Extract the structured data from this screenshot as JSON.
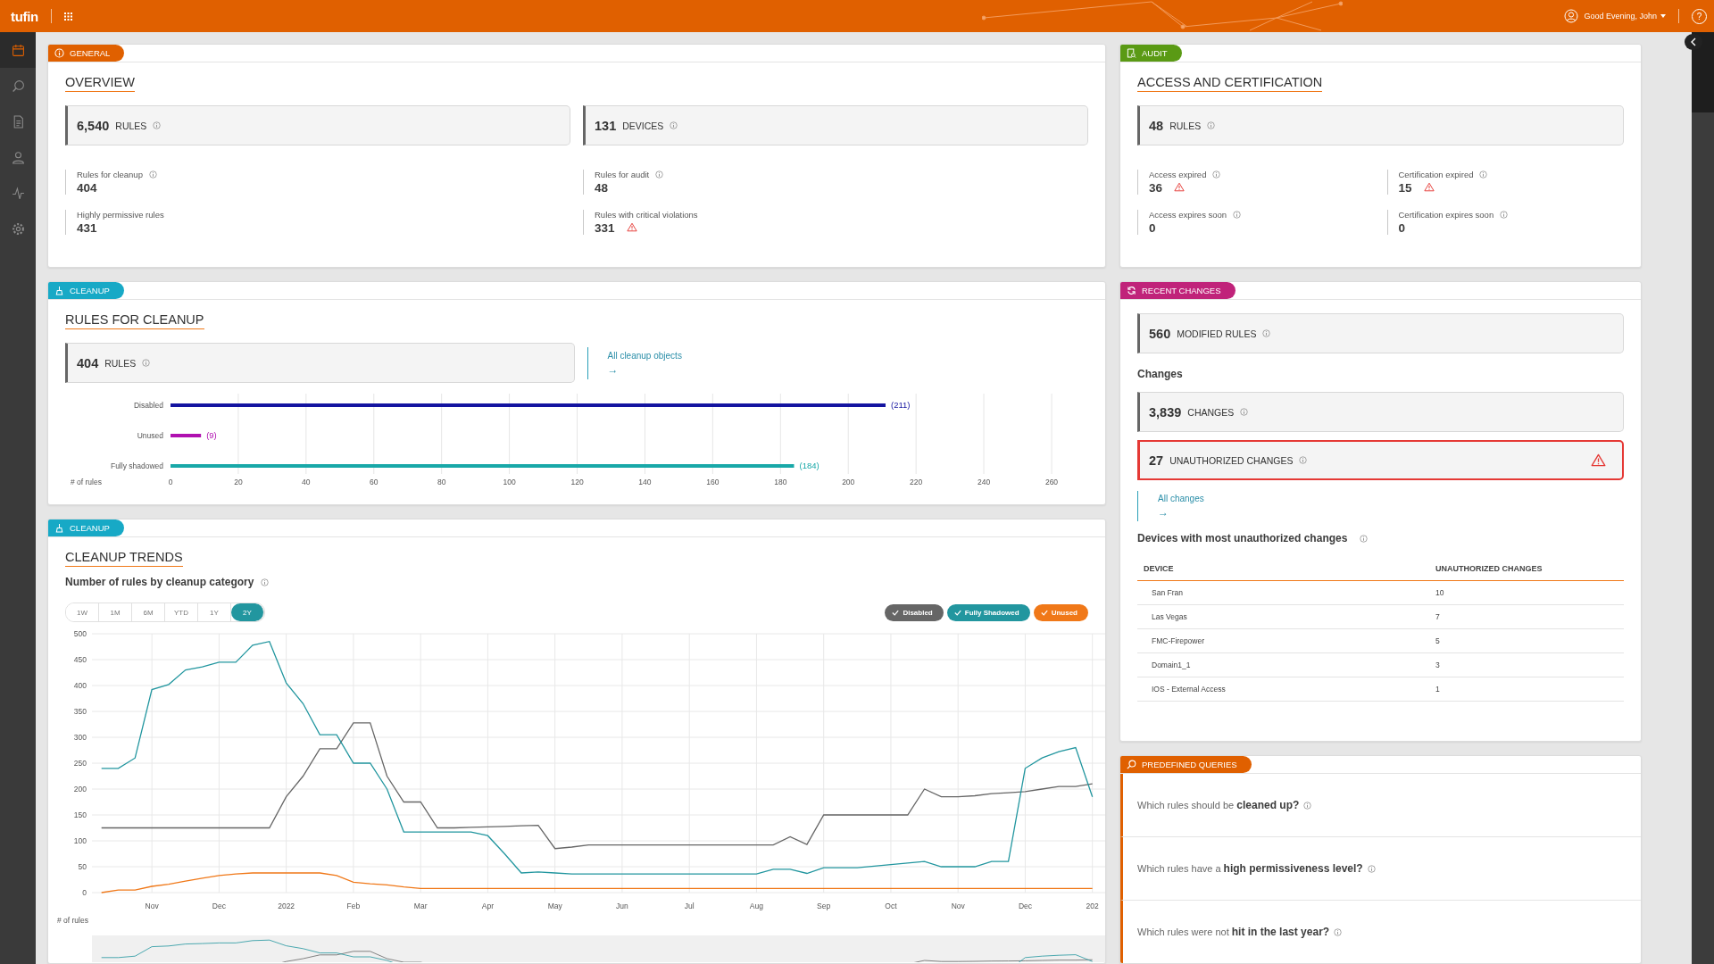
{
  "top_bar": {
    "logo": "tufin",
    "greeting": "Good Evening, John",
    "help": "?"
  },
  "sidebar": {
    "items": [
      {
        "selected": true
      },
      {
        "selected": false
      },
      {
        "selected": false
      },
      {
        "selected": false
      },
      {
        "selected": false
      },
      {
        "selected": false
      }
    ]
  },
  "general": {
    "tag": {
      "label": "GENERAL",
      "color": "#e06000"
    },
    "title": "OVERVIEW",
    "stats": [
      {
        "value": "6,540",
        "label": "RULES",
        "alert": false
      },
      {
        "value": "131",
        "label": "DEVICES",
        "alert": false
      }
    ],
    "metrics": [
      {
        "label": "Rules for cleanup",
        "value": "404",
        "info": true,
        "warning": false
      },
      {
        "label": "Rules for audit",
        "value": "48",
        "info": true,
        "warning": false
      },
      {
        "label": "Highly permissive rules",
        "value": "431",
        "info": false,
        "warning": false
      },
      {
        "label": "Rules with critical violations",
        "value": "331",
        "info": false,
        "warning": true
      }
    ]
  },
  "cleanup": {
    "tag": {
      "label": "CLEANUP",
      "color": "#17a9c6"
    },
    "title": "RULES FOR CLEANUP",
    "stat": {
      "value": "404",
      "label": "RULES",
      "alert": false
    },
    "link": {
      "label": "All cleanup objects",
      "arrow": "→"
    },
    "axis_caption": "# of rules",
    "chart_data": {
      "type": "bar",
      "orientation": "horizontal",
      "series": [
        {
          "name": "Disabled",
          "color": "#1414a0",
          "values": [
            211
          ]
        },
        {
          "name": "Unused",
          "color": "#b010b0",
          "values": [
            9
          ]
        },
        {
          "name": "Fully shadowed",
          "color": "#18a8a8",
          "values": [
            184
          ]
        }
      ],
      "value_labels": [
        "(211)",
        "(9)",
        "(184)"
      ],
      "grid": true,
      "xlim": [
        0,
        260
      ],
      "xticks": [
        0,
        20,
        40,
        60,
        80,
        100,
        120,
        140,
        160,
        180,
        200,
        220,
        240,
        260
      ]
    }
  },
  "trends": {
    "tag": {
      "label": "CLEANUP",
      "color": "#17a9c6"
    },
    "title": "CLEANUP TRENDS",
    "ranges": [
      {
        "label": "1W",
        "selected": false
      },
      {
        "label": "1M",
        "selected": false
      },
      {
        "label": "6M",
        "selected": false
      },
      {
        "label": "YTD",
        "selected": false
      },
      {
        "label": "1Y",
        "selected": false
      },
      {
        "label": "2Y",
        "selected": true
      }
    ],
    "legend": [
      {
        "checked": true
      },
      {
        "checked": true
      },
      {
        "checked": true
      }
    ],
    "chart_data": {
      "type": "line",
      "grid": true,
      "title": "Number of rules by cleanup category",
      "ylabel": "# of rules",
      "ylim": [
        0,
        500
      ],
      "yticks": [
        0,
        50,
        100,
        150,
        200,
        250,
        300,
        350,
        400,
        450,
        500
      ],
      "categories": [
        null,
        null,
        null,
        "Nov",
        null,
        null,
        null,
        "Dec",
        null,
        null,
        null,
        "2022",
        null,
        null,
        null,
        "Feb",
        null,
        null,
        null,
        "Mar",
        null,
        null,
        null,
        "Apr",
        null,
        null,
        null,
        "May",
        null,
        null,
        null,
        "Jun",
        null,
        null,
        null,
        "Jul",
        null,
        null,
        null,
        "Aug",
        null,
        null,
        null,
        "Sep",
        null,
        null,
        null,
        "Oct",
        null,
        null,
        null,
        "Nov",
        null,
        null,
        null,
        "Dec",
        null,
        null,
        null,
        "202"
      ],
      "series": [
        {
          "name": "Disabled",
          "color": "#666666",
          "values": [
            125,
            125,
            125,
            125,
            125,
            125,
            125,
            125,
            125,
            125,
            125,
            185,
            225,
            278,
            278,
            328,
            328,
            225,
            175,
            175,
            125,
            125,
            126,
            127,
            128,
            129,
            130,
            85,
            88,
            92,
            92,
            92,
            92,
            92,
            92,
            92,
            92,
            92,
            92,
            92,
            92,
            108,
            93,
            150,
            150,
            150,
            150,
            150,
            150,
            200,
            185,
            185,
            187,
            191,
            193,
            195,
            200,
            205,
            205,
            210
          ]
        },
        {
          "name": "Fully Shadowed",
          "color": "#22969f",
          "values": [
            240,
            240,
            260,
            392,
            402,
            430,
            436,
            445,
            445,
            478,
            485,
            405,
            365,
            305,
            305,
            250,
            250,
            200,
            117,
            117,
            117,
            117,
            117,
            110,
            75,
            38,
            40,
            38,
            36,
            36,
            36,
            36,
            36,
            36,
            36,
            36,
            36,
            36,
            36,
            36,
            45,
            45,
            37,
            48,
            48,
            48,
            51,
            54,
            57,
            60,
            50,
            50,
            50,
            60,
            60,
            240,
            260,
            272,
            280,
            185
          ]
        },
        {
          "name": "Unused",
          "color": "#f07818",
          "values": [
            0,
            5,
            5,
            12,
            16,
            22,
            28,
            33,
            36,
            38,
            38,
            38,
            38,
            38,
            33,
            20,
            17,
            15,
            11,
            8,
            8,
            8,
            8,
            8,
            8,
            8,
            8,
            8,
            8,
            8,
            8,
            8,
            8,
            8,
            8,
            8,
            8,
            8,
            8,
            8,
            8,
            8,
            8,
            8,
            8,
            8,
            8,
            8,
            8,
            8,
            8,
            8,
            8,
            8,
            8,
            8,
            8,
            8,
            8,
            8
          ]
        }
      ]
    }
  },
  "audit": {
    "tag": {
      "label": "AUDIT",
      "color": "#5a9a14"
    },
    "title": "ACCESS AND CERTIFICATION",
    "stat": {
      "value": "48",
      "label": "RULES",
      "alert": false
    },
    "metrics": [
      {
        "label": "Access expired",
        "value": "36",
        "info": true,
        "warning": true
      },
      {
        "label": "Certification expired",
        "value": "15",
        "info": true,
        "warning": true
      },
      {
        "label": "Access expires soon",
        "value": "0",
        "info": true,
        "warning": false
      },
      {
        "label": "Certification expires soon",
        "value": "0",
        "info": true,
        "warning": false
      }
    ]
  },
  "recent_changes": {
    "tag": {
      "label": "RECENT CHANGES",
      "color": "#c0237a"
    },
    "stat": {
      "value": "560",
      "label": "MODIFIED RULES",
      "alert": false
    },
    "changes_heading": "Changes",
    "change_stats": [
      {
        "value": "3,839",
        "label": "CHANGES",
        "alert": false
      },
      {
        "value": "27",
        "label": "UNAUTHORIZED CHANGES",
        "alert": true
      }
    ],
    "link": {
      "label": "All changes",
      "arrow": "→"
    },
    "devices_heading": "Devices with most unauthorized changes",
    "table": {
      "columns": [
        "DEVICE",
        "UNAUTHORIZED CHANGES"
      ],
      "rows": [
        [
          "San Fran",
          "10"
        ],
        [
          "Las Vegas",
          "7"
        ],
        [
          "FMC-Firepower",
          "5"
        ],
        [
          "Domain1_1",
          "3"
        ],
        [
          "IOS - External Access",
          "1"
        ]
      ]
    }
  },
  "queries": {
    "tag": {
      "label": "PREDEFINED QUERIES",
      "color": "#e06000"
    },
    "items": [
      "Which rules should be **cleaned up?**",
      "Which rules have a **high permissiveness level?**",
      "Which rules were not **hit in the last year?**"
    ]
  }
}
